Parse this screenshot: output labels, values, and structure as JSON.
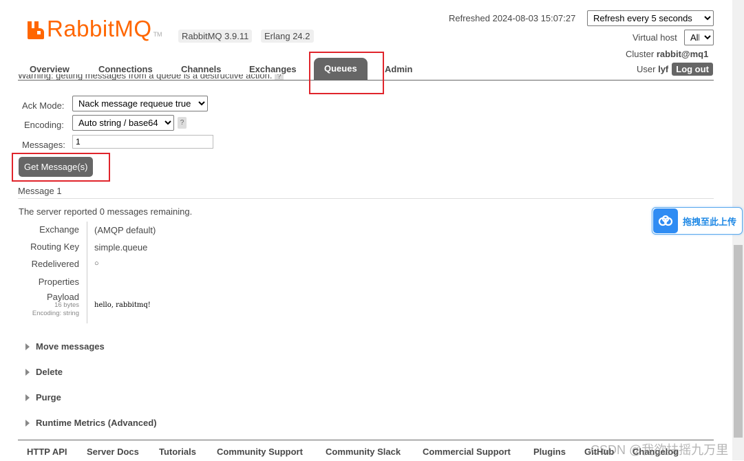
{
  "header": {
    "logo_text": "RabbitMQ",
    "logo_tm": "TM",
    "version_badge": "RabbitMQ 3.9.11",
    "erlang_badge": "Erlang 24.2",
    "refreshed_text": "Refreshed 2024-08-03 15:07:27",
    "refresh_select": "Refresh every 5 seconds",
    "vhost_label": "Virtual host",
    "vhost_select": "All",
    "cluster_label": "Cluster",
    "cluster_name": "rabbit@mq1",
    "user_label": "User",
    "user_name": "lyf",
    "logout_label": "Log out"
  },
  "tabs": [
    {
      "label": "Overview"
    },
    {
      "label": "Connections"
    },
    {
      "label": "Channels"
    },
    {
      "label": "Exchanges"
    },
    {
      "label": "Queues",
      "active": true
    },
    {
      "label": "Admin"
    }
  ],
  "warning_text": "Warning: getting messages from a queue is a destructive action.",
  "get_form": {
    "ack_label": "Ack Mode:",
    "ack_value": "Nack message requeue true",
    "encoding_label": "Encoding:",
    "encoding_value": "Auto string / base64",
    "help": "?",
    "messages_label": "Messages:",
    "messages_value": "1",
    "get_button": "Get Message(s)"
  },
  "message": {
    "heading": "Message 1",
    "server_prefix": "The server reported",
    "server_count": "0",
    "server_suffix": "messages remaining.",
    "exchange_label": "Exchange",
    "exchange_value": "(AMQP default)",
    "routing_label": "Routing Key",
    "routing_value": "simple.queue",
    "redelivered_label": "Redelivered",
    "redelivered_value": "○",
    "properties_label": "Properties",
    "payload_label": "Payload",
    "payload_bytes": "16 bytes",
    "payload_encoding": "Encoding: string",
    "payload_value": "hello, rabbitmq!"
  },
  "sections": [
    "Move messages",
    "Delete",
    "Purge",
    "Runtime Metrics (Advanced)"
  ],
  "footer": [
    "HTTP API",
    "Server Docs",
    "Tutorials",
    "Community Support",
    "Community Slack",
    "Commercial Support",
    "Plugins",
    "GitHub",
    "Changelog"
  ],
  "upload_widget": {
    "label": "拖拽至此上传"
  },
  "watermark": "CSDN @我欲扶摇九万里",
  "colors": {
    "brand": "#ff6600",
    "tab_active": "#666666",
    "highlight": "#e0242b"
  }
}
